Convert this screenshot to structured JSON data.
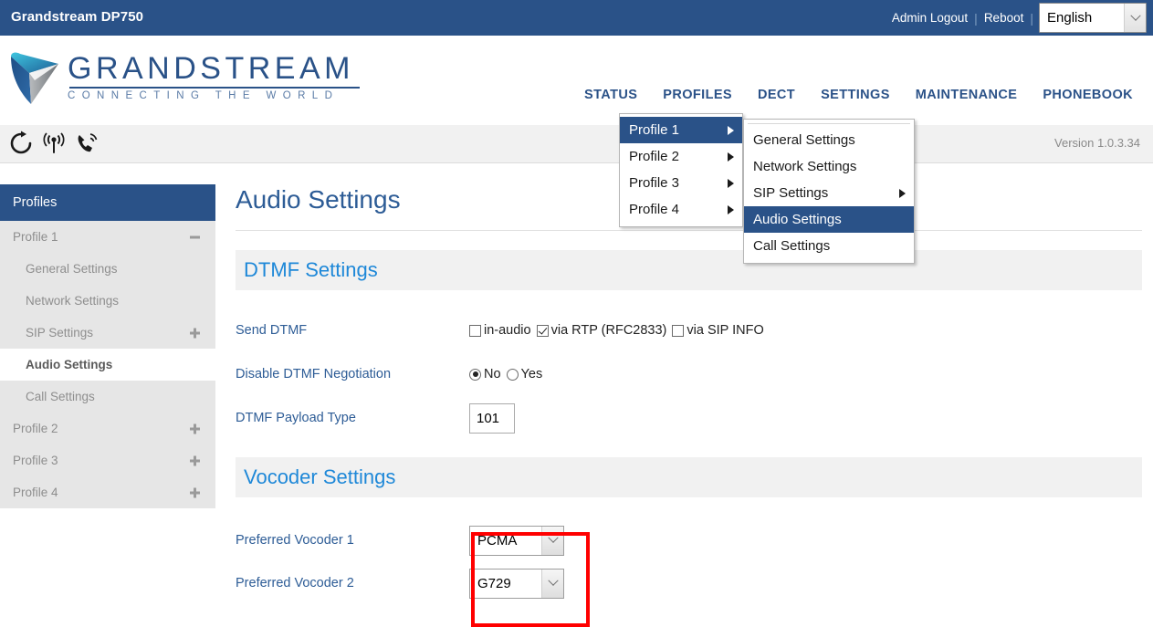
{
  "topbar": {
    "device_title": "Grandstream DP750",
    "logout_label": "Admin Logout",
    "reboot_label": "Reboot",
    "separator": "|",
    "language_value": "English",
    "language_options": [
      "English"
    ]
  },
  "brand": {
    "name": "GRANDSTREAM",
    "tagline": "CONNECTING THE WORLD",
    "primary_color": "#2a5288",
    "accent_color": "#1e88d8"
  },
  "mainnav": {
    "items": [
      {
        "label": "STATUS"
      },
      {
        "label": "PROFILES"
      },
      {
        "label": "DECT"
      },
      {
        "label": "SETTINGS"
      },
      {
        "label": "MAINTENANCE"
      },
      {
        "label": "PHONEBOOK"
      }
    ]
  },
  "statusbar": {
    "icons": [
      {
        "name": "refresh-icon"
      },
      {
        "name": "dect-radio-icon"
      },
      {
        "name": "handset-call-icon"
      }
    ],
    "version_label": "Version 1.0.3.34"
  },
  "profiles_menu": {
    "items": [
      {
        "label": "Profile 1",
        "has_submenu": true,
        "selected": true
      },
      {
        "label": "Profile 2",
        "has_submenu": true,
        "selected": false
      },
      {
        "label": "Profile 3",
        "has_submenu": true,
        "selected": false
      },
      {
        "label": "Profile 4",
        "has_submenu": true,
        "selected": false
      }
    ]
  },
  "profile1_submenu": {
    "items": [
      {
        "label": "General Settings",
        "has_submenu": false,
        "selected": false
      },
      {
        "label": "Network Settings",
        "has_submenu": false,
        "selected": false
      },
      {
        "label": "SIP Settings",
        "has_submenu": true,
        "selected": false
      },
      {
        "label": "Audio Settings",
        "has_submenu": false,
        "selected": true
      },
      {
        "label": "Call Settings",
        "has_submenu": false,
        "selected": false
      }
    ]
  },
  "sidebar": {
    "header": "Profiles",
    "items": [
      {
        "label": "Profile 1",
        "level": 1,
        "active": false,
        "expander": "minus"
      },
      {
        "label": "General Settings",
        "level": 2,
        "active": false,
        "expander": "none"
      },
      {
        "label": "Network Settings",
        "level": 2,
        "active": false,
        "expander": "none"
      },
      {
        "label": "SIP Settings",
        "level": 2,
        "active": false,
        "expander": "plus"
      },
      {
        "label": "Audio Settings",
        "level": 2,
        "active": true,
        "expander": "none"
      },
      {
        "label": "Call Settings",
        "level": 2,
        "active": false,
        "expander": "none"
      },
      {
        "label": "Profile 2",
        "level": 1,
        "active": false,
        "expander": "plus"
      },
      {
        "label": "Profile 3",
        "level": 1,
        "active": false,
        "expander": "plus"
      },
      {
        "label": "Profile 4",
        "level": 1,
        "active": false,
        "expander": "plus"
      }
    ]
  },
  "main": {
    "page_title": "Audio Settings",
    "sections": [
      {
        "heading": "DTMF Settings",
        "rows": [
          {
            "label": "Send DTMF",
            "type": "checkbox_group",
            "options": [
              {
                "label": "in-audio",
                "checked": false
              },
              {
                "label": "via RTP (RFC2833)",
                "checked": true
              },
              {
                "label": "via SIP INFO",
                "checked": false
              }
            ]
          },
          {
            "label": "Disable DTMF Negotiation",
            "type": "radio_group",
            "options": [
              {
                "label": "No",
                "checked": true
              },
              {
                "label": "Yes",
                "checked": false
              }
            ]
          },
          {
            "label": "DTMF Payload Type",
            "type": "text",
            "value": "101"
          }
        ]
      },
      {
        "heading": "Vocoder Settings",
        "rows": [
          {
            "label": "Preferred Vocoder 1",
            "type": "select",
            "value": "PCMA"
          },
          {
            "label": "Preferred Vocoder 2",
            "type": "select",
            "value": "G729"
          }
        ]
      }
    ]
  },
  "highlight": {
    "color": "#ff0000",
    "target": "preferred-vocoder-selects"
  }
}
